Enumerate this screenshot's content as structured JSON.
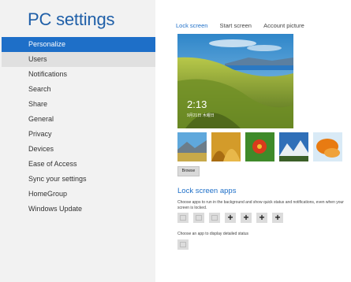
{
  "sidebar": {
    "title": "PC settings",
    "items": [
      {
        "label": "Personalize"
      },
      {
        "label": "Users"
      },
      {
        "label": "Notifications"
      },
      {
        "label": "Search"
      },
      {
        "label": "Share"
      },
      {
        "label": "General"
      },
      {
        "label": "Privacy"
      },
      {
        "label": "Devices"
      },
      {
        "label": "Ease of Access"
      },
      {
        "label": "Sync your settings"
      },
      {
        "label": "HomeGroup"
      },
      {
        "label": "Windows Update"
      }
    ]
  },
  "main": {
    "tabs": [
      {
        "label": "Lock screen"
      },
      {
        "label": "Start screen"
      },
      {
        "label": "Account picture"
      }
    ],
    "preview": {
      "time": "2:13",
      "date": "9月21日 木曜日"
    },
    "thumbnails": [
      "mountain-lake",
      "golden-grass",
      "red-flower",
      "mountain-peaks",
      "orange-leaf"
    ],
    "browse_label": "Browse",
    "lock_apps": {
      "title": "Lock screen apps",
      "description": "Choose apps to run in the background and show quick status and notifications, even when your screen is locked.",
      "slots": [
        "message-icon",
        "mail-icon",
        "calendar-icon",
        "add-icon",
        "add-icon",
        "add-icon",
        "add-icon"
      ],
      "detail_description": "Choose an app to display detailed status",
      "detail_slot": "calendar-icon"
    }
  },
  "colors": {
    "accent": "#1e6fc8",
    "sidebar_bg": "#f2f2f2",
    "title": "#1f5fa8"
  }
}
